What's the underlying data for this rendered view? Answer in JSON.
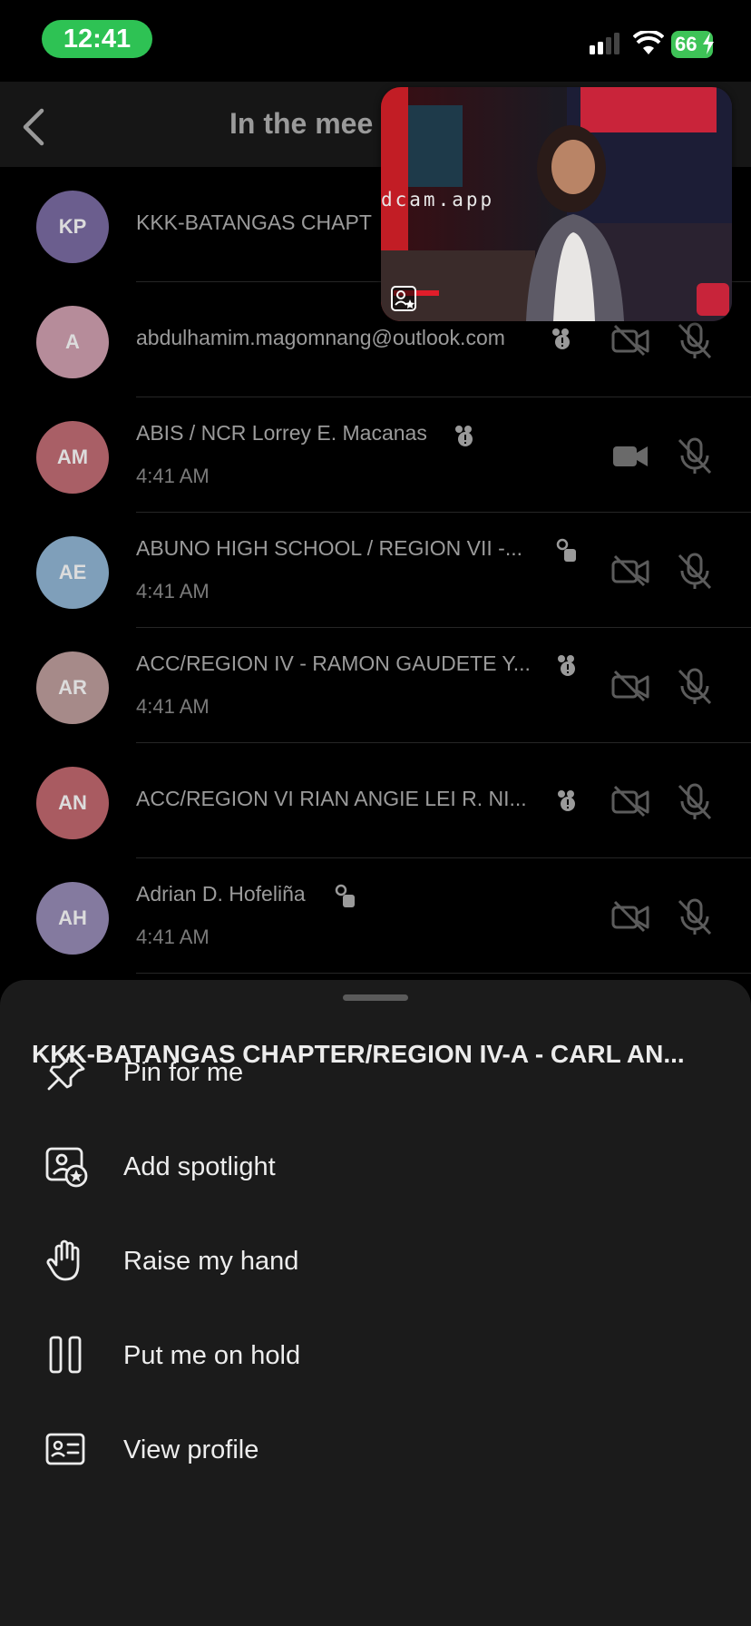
{
  "status_bar": {
    "time": "12:41",
    "battery": "66"
  },
  "header": {
    "title": "In the mee"
  },
  "pip": {
    "overlay_text": "dcam.app"
  },
  "participants": [
    {
      "initials": "KP",
      "color": "#6b5e8e",
      "name": "KKK-BATANGAS CHAPT",
      "time": ""
    },
    {
      "initials": "A",
      "color": "#b68c9a",
      "name": "abdulhamim.magomnang@outlook.com",
      "time": ""
    },
    {
      "initials": "AM",
      "color": "#a95f66",
      "name": "ABIS / NCR Lorrey E. Macanas",
      "time": "4:41 AM"
    },
    {
      "initials": "AE",
      "color": "#7f9fba",
      "name": "ABUNO HIGH SCHOOL / REGION VII -...",
      "time": "4:41 AM"
    },
    {
      "initials": "AR",
      "color": "#a68a89",
      "name": "ACC/REGION IV - RAMON GAUDETE Y...",
      "time": "4:41 AM"
    },
    {
      "initials": "AN",
      "color": "#a95b61",
      "name": "ACC/REGION VI RIAN ANGIE LEI R. NI...",
      "time": ""
    },
    {
      "initials": "AH",
      "color": "#847a9f",
      "name": "Adrian D. Hofeliña",
      "time": "4:41 AM"
    }
  ],
  "sheet": {
    "title": "KKK-BATANGAS CHAPTER/REGION IV-A - CARL AN...",
    "actions": [
      {
        "label": "Pin for me"
      },
      {
        "label": "Add spotlight"
      },
      {
        "label": "Raise my hand"
      },
      {
        "label": "Put me on hold"
      },
      {
        "label": "View profile"
      }
    ]
  }
}
